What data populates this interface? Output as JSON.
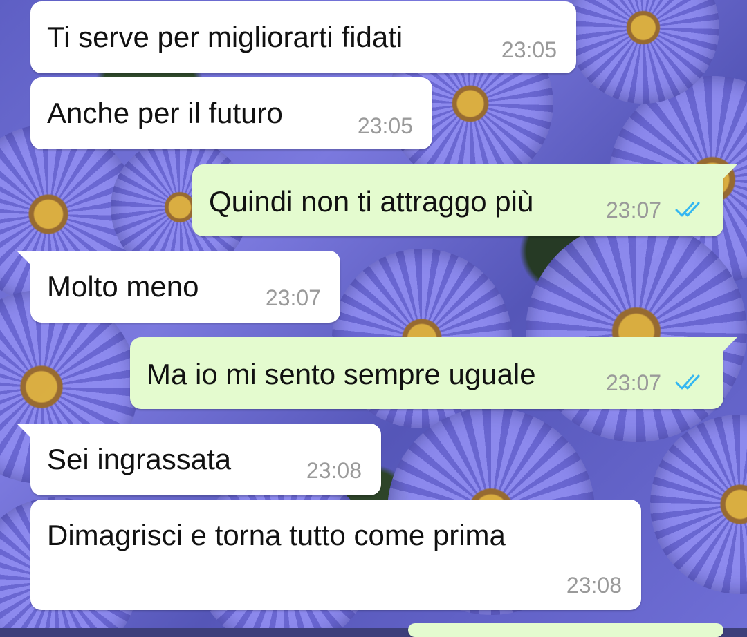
{
  "colors": {
    "incoming_bubble": "#ffffff",
    "outgoing_bubble": "#e4fbcf",
    "time_text": "#9a9a9a",
    "read_ticks": "#34b7f1"
  },
  "messages": [
    {
      "direction": "incoming",
      "text": "Ti serve per migliorarti fidati",
      "time": "23:05"
    },
    {
      "direction": "incoming",
      "text": "Anche per il futuro",
      "time": "23:05"
    },
    {
      "direction": "outgoing",
      "text": "Quindi non ti attraggo più",
      "time": "23:07",
      "status": "read"
    },
    {
      "direction": "incoming",
      "text": "Molto meno",
      "time": "23:07"
    },
    {
      "direction": "outgoing",
      "text": "Ma io mi sento sempre uguale",
      "time": "23:07",
      "status": "read"
    },
    {
      "direction": "incoming",
      "text": "Sei ingrassata",
      "time": "23:08"
    },
    {
      "direction": "incoming",
      "text": "Dimagrisci e torna tutto come prima",
      "time": "23:08"
    }
  ]
}
